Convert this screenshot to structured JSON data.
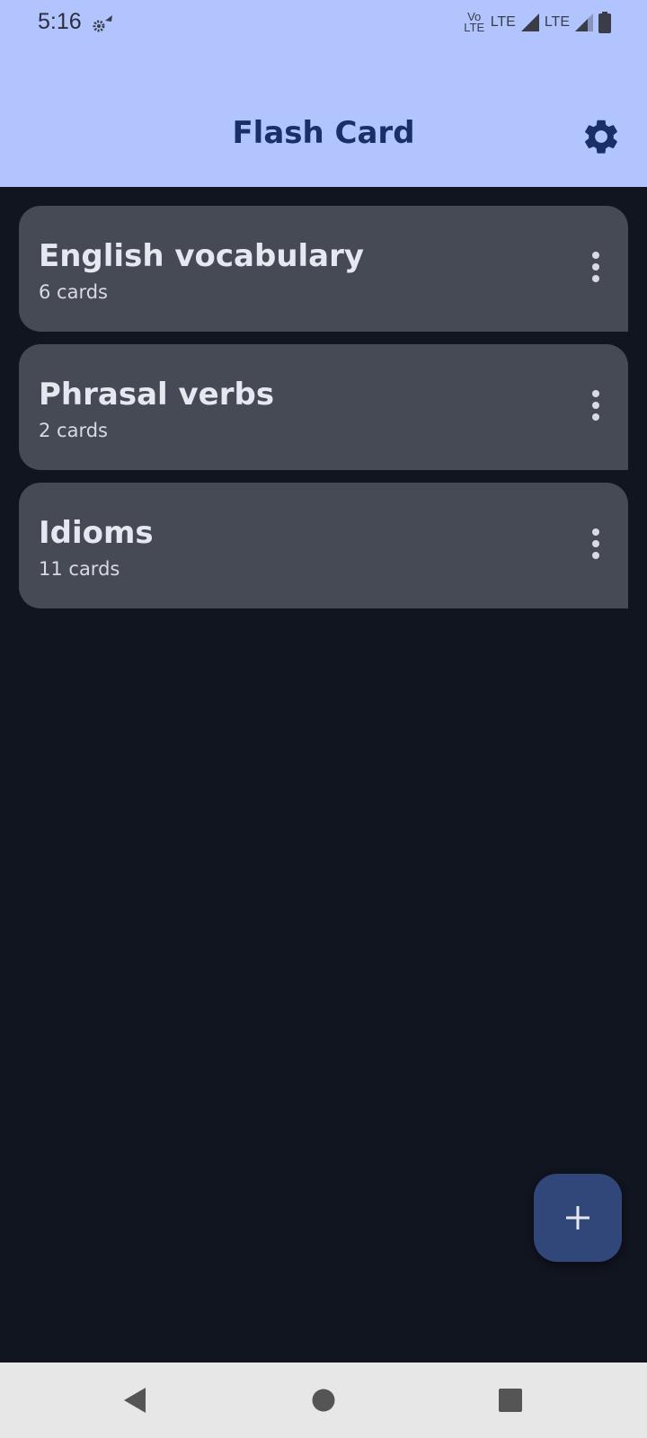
{
  "status_bar": {
    "time": "5:16",
    "network_label": "Vo LTE",
    "lte_1": "LTE",
    "lte_2": "LTE"
  },
  "app_bar": {
    "title": "Flash Card",
    "settings_icon": "gear-icon"
  },
  "decks": [
    {
      "name": "English vocabulary",
      "count": "6 cards"
    },
    {
      "name": "Phrasal verbs",
      "count": "2 cards"
    },
    {
      "name": "Idioms",
      "count": "11 cards"
    }
  ],
  "fab": {
    "icon": "plus-icon"
  },
  "nav_bar": {
    "back_icon": "back-triangle-icon",
    "home_icon": "home-circle-icon",
    "recents_icon": "recents-square-icon"
  },
  "colors": {
    "app_bar_bg": "#b1c4fe",
    "title": "#1a2f66",
    "background": "#111520",
    "card_bg": "#464a55",
    "fab_bg": "#314679",
    "nav_bar_bg": "#e7e7e7"
  }
}
